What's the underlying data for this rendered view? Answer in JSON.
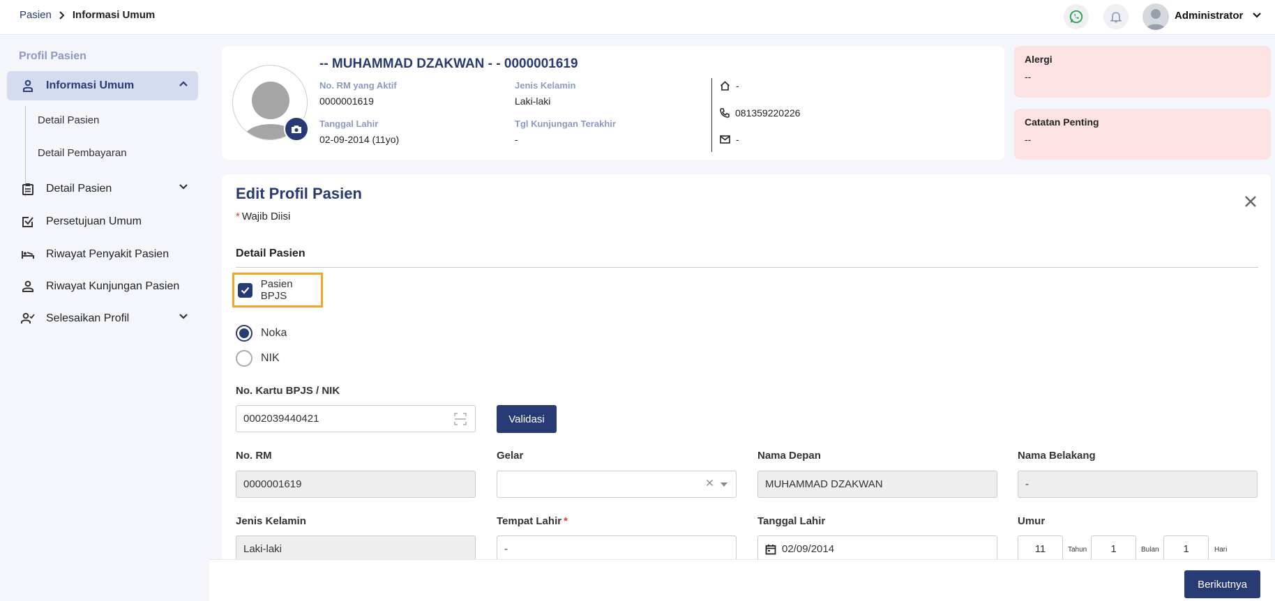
{
  "breadcrumb": {
    "parent": "Pasien",
    "current": "Informasi Umum"
  },
  "header": {
    "user_name": "Administrator"
  },
  "colors": {
    "primary": "#283a73",
    "alert_bg": "#fde2e4",
    "highlight": "#f5a623",
    "whatsapp": "#25a244"
  },
  "sidebar": {
    "title": "Profil Pasien",
    "items": [
      {
        "label": "Informasi Umum",
        "icon": "person-icon"
      },
      {
        "label": "Detail Pasien",
        "icon": "clipboard-icon"
      },
      {
        "label": "Persetujuan Umum",
        "icon": "checkbox-icon"
      },
      {
        "label": "Riwayat Penyakit Pasien",
        "icon": "bed-icon"
      },
      {
        "label": "Riwayat Kunjungan Pasien",
        "icon": "person-outline-icon"
      },
      {
        "label": "Selesaikan Profil",
        "icon": "person-check-icon"
      }
    ],
    "subitems": [
      "Detail Pasien",
      "Detail Pembayaran"
    ]
  },
  "patient": {
    "name": "-- MUHAMMAD DZAKWAN - - 0000001619",
    "rm_label": "No. RM yang Aktif",
    "rm_value": "0000001619",
    "gender_label": "Jenis Kelamin",
    "gender_value": "Laki-laki",
    "dob_label": "Tanggal Lahir",
    "dob_value": "02-09-2014 (11yo)",
    "last_visit_label": "Tgl Kunjungan Terakhir",
    "last_visit_value": "-",
    "address": "-",
    "phone": "081359220226",
    "email": "-"
  },
  "alerts": {
    "allergy_title": "Alergi",
    "allergy_value": "--",
    "notes_title": "Catatan Penting",
    "notes_value": "--"
  },
  "form": {
    "title": "Edit Profil Pasien",
    "required_star": "*",
    "required_note": "Wajib Diisi",
    "section": "Detail Pasien",
    "bpjs_label": "Pasien BPJS",
    "bpjs_checked": true,
    "radio_noka": "Noka",
    "radio_nik": "NIK",
    "radio_selected": "Noka",
    "card_label": "No. Kartu BPJS / NIK",
    "card_value": "0002039440421",
    "validate_button": "Validasi",
    "rm_label": "No. RM",
    "rm_value": "0000001619",
    "title_label": "Gelar",
    "title_value": "",
    "first_name_label": "Nama Depan",
    "first_name_value": "MUHAMMAD DZAKWAN",
    "last_name_label": "Nama Belakang",
    "last_name_value": "-",
    "gender_label": "Jenis Kelamin",
    "gender_value": "Laki-laki",
    "birthplace_label": "Tempat Lahir",
    "birthplace_value": "-",
    "dob_label": "Tanggal Lahir",
    "dob_value": "02/09/2014",
    "age_label": "Umur",
    "age_years": "11",
    "age_years_unit": "Tahun",
    "age_months": "1",
    "age_months_unit": "Bulan",
    "age_days": "1",
    "age_days_unit": "Hari"
  },
  "footer": {
    "next_button": "Berikutnya"
  }
}
